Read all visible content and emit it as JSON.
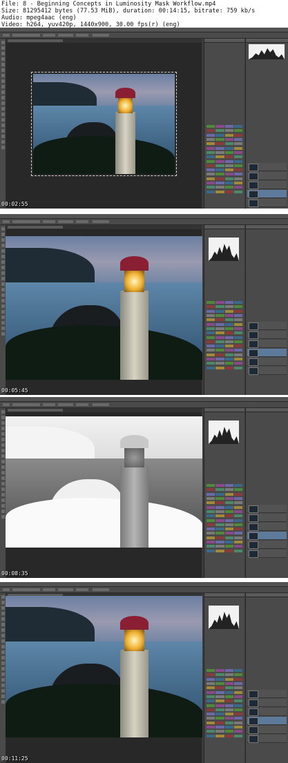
{
  "header": {
    "file": "File: 8 - Beginning Concepts in Luminosity Mask Workflow.mp4",
    "size": "Size: 81295412 bytes (77.53 MiB), duration: 00:14:15, bitrate: 759 kb/s",
    "audio": "Audio: mpeg4aac (eng)",
    "video": "Video: h264, yuv420p, 1440x900, 30.00 fps(r) (eng)"
  },
  "frames": [
    {
      "timestamp": "00:02:55",
      "photo_mode": "color-framed"
    },
    {
      "timestamp": "00:05:45",
      "photo_mode": "color"
    },
    {
      "timestamp": "00:08:35",
      "photo_mode": "inverted-mask"
    },
    {
      "timestamp": "00:11:25",
      "photo_mode": "color"
    }
  ],
  "colors": {
    "workspace": "#3a3a3a",
    "panel": "#4a4a4a",
    "layer_selected": "#5d7a9a",
    "lighthouse_roof": "#8a1f33",
    "lamp_glow": "#f0b030"
  }
}
